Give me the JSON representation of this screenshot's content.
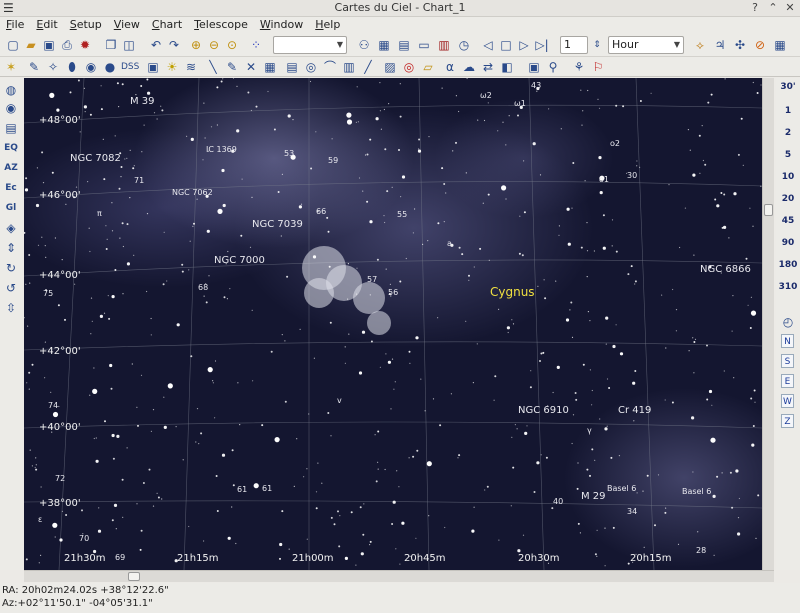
{
  "window": {
    "title": "Cartes du Ciel - Chart_1",
    "help_btn": "?",
    "min_btn": "⌃",
    "close_btn": "✕"
  },
  "menu": [
    "File",
    "Edit",
    "Setup",
    "View",
    "Chart",
    "Telescope",
    "Window",
    "Help"
  ],
  "toolbar": {
    "zoom_value": "1",
    "time_unit": "Hour",
    "search_value": ""
  },
  "fov_labels": [
    "30'",
    "1",
    "2",
    "5",
    "10",
    "20",
    "45",
    "90",
    "180",
    "310"
  ],
  "direction_buttons": [
    "N",
    "S",
    "E",
    "W",
    "Z"
  ],
  "left_labels": {
    "eq": "EQ",
    "az": "AZ",
    "ec": "Ec",
    "gl": "Gl"
  },
  "dss_label": "DSS",
  "status": {
    "ra": "RA: 20h02m24.02s +38°12'22.6\"",
    "az": "Az:+02°11'50.1\" -04°05'31.1\""
  },
  "chart": {
    "constellation": "Cygnus",
    "dec_labels": [
      "+48°00'",
      "+46°00'",
      "+44°00'",
      "+42°00'",
      "+40°00'",
      "+38°00'"
    ],
    "ra_labels": [
      "21h30m",
      "21h15m",
      "21h00m",
      "20h45m",
      "20h30m",
      "20h15m"
    ],
    "objects": [
      "M 39",
      "NGC 7082",
      "IC 1369",
      "NGC 7062",
      "NGC 7039",
      "NGC 7000",
      "NGC 6866",
      "NGC 6910",
      "Cr 419",
      "M 29",
      "Basel 6",
      "Basel 6"
    ],
    "star_labels": [
      "43",
      "ω2",
      "ω1",
      "53",
      "59",
      "o2",
      "71",
      "o1",
      "30",
      "55",
      "66",
      "π",
      "a",
      "68",
      "75",
      "57",
      "56",
      "74",
      "v",
      "72",
      "γ",
      "61",
      "61",
      "40",
      "34",
      "70",
      "69",
      "28",
      "ε"
    ]
  }
}
